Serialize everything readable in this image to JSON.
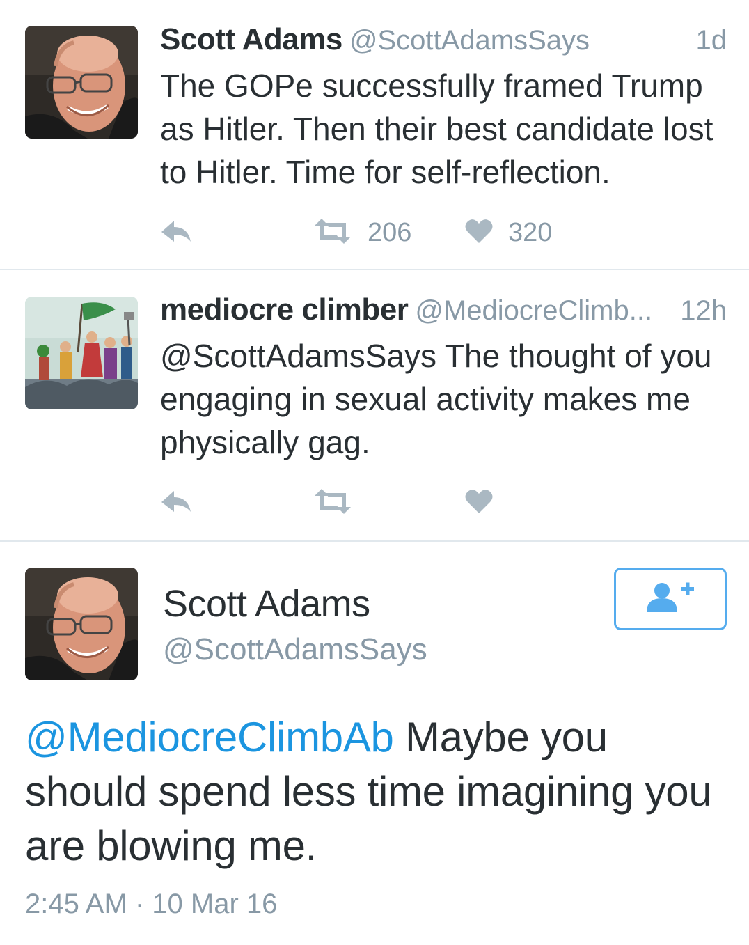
{
  "tweets": [
    {
      "name": "Scott Adams",
      "handle": "@ScottAdamsSays",
      "time": "1d",
      "text": "The GOPe successfully framed Trump as Hitler. Then their best candidate lost to Hitler. Time for self-reflection.",
      "retweets": "206",
      "likes": "320",
      "avatar": "scott-adams-photo"
    },
    {
      "name": "mediocre climber",
      "handle": "@MediocreClimb...",
      "time": "12h",
      "text": "@ScottAdamsSays The thought of you engaging in sexual activity makes me physically gag.",
      "retweets": "",
      "likes": "",
      "avatar": "illustrated-crowd-with-flag"
    }
  ],
  "detail": {
    "name": "Scott Adams",
    "handle": "@ScottAdamsSays",
    "mention": "@MediocreClimbAb",
    "text": " Maybe you should spend less time imagining you are blowing me.",
    "timestamp": "2:45 AM · 10 Mar 16",
    "follow_icon": "add-user-icon"
  },
  "icons": {
    "reply": "reply-icon",
    "retweet": "retweet-icon",
    "like": "heart-icon"
  },
  "colors": {
    "accent": "#55acee",
    "link": "#1b95e0",
    "muted": "#8899a6",
    "text": "#292f33",
    "divider": "#e1e8ed"
  }
}
